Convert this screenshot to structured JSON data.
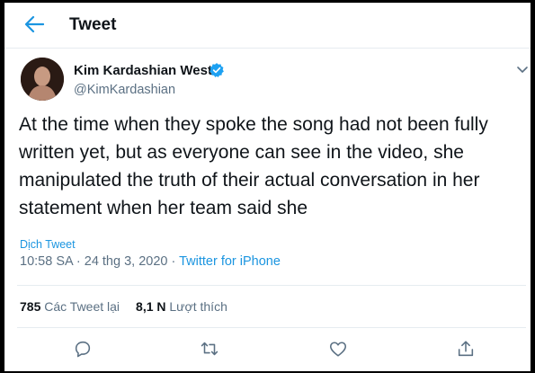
{
  "header": {
    "title": "Tweet"
  },
  "tweet": {
    "author_name": "Kim Kardashian West",
    "handle": "@KimKardashian",
    "text": "At the time when they spoke the song had not been fully written yet, but as everyone can see in the video, she manipulated the truth of their actual conversation in her statement when her team said she",
    "translate_label": "Dịch Tweet",
    "time": "10:58 SA",
    "date_sep": " · ",
    "date": "24 thg 3, 2020",
    "source_sep": " · ",
    "source": "Twitter for iPhone"
  },
  "stats": {
    "retweets_count": "785",
    "retweets_label": "Các Tweet lại",
    "likes_count": "8,1 N",
    "likes_label": "Lượt thích"
  },
  "colors": {
    "accent": "#1b95e0",
    "secondary_text": "#5b7083",
    "divider": "#e6ecf0"
  },
  "icons": [
    "back-arrow-icon",
    "verified-badge-icon",
    "chevron-down-icon",
    "reply-icon",
    "retweet-icon",
    "like-icon",
    "share-icon"
  ]
}
